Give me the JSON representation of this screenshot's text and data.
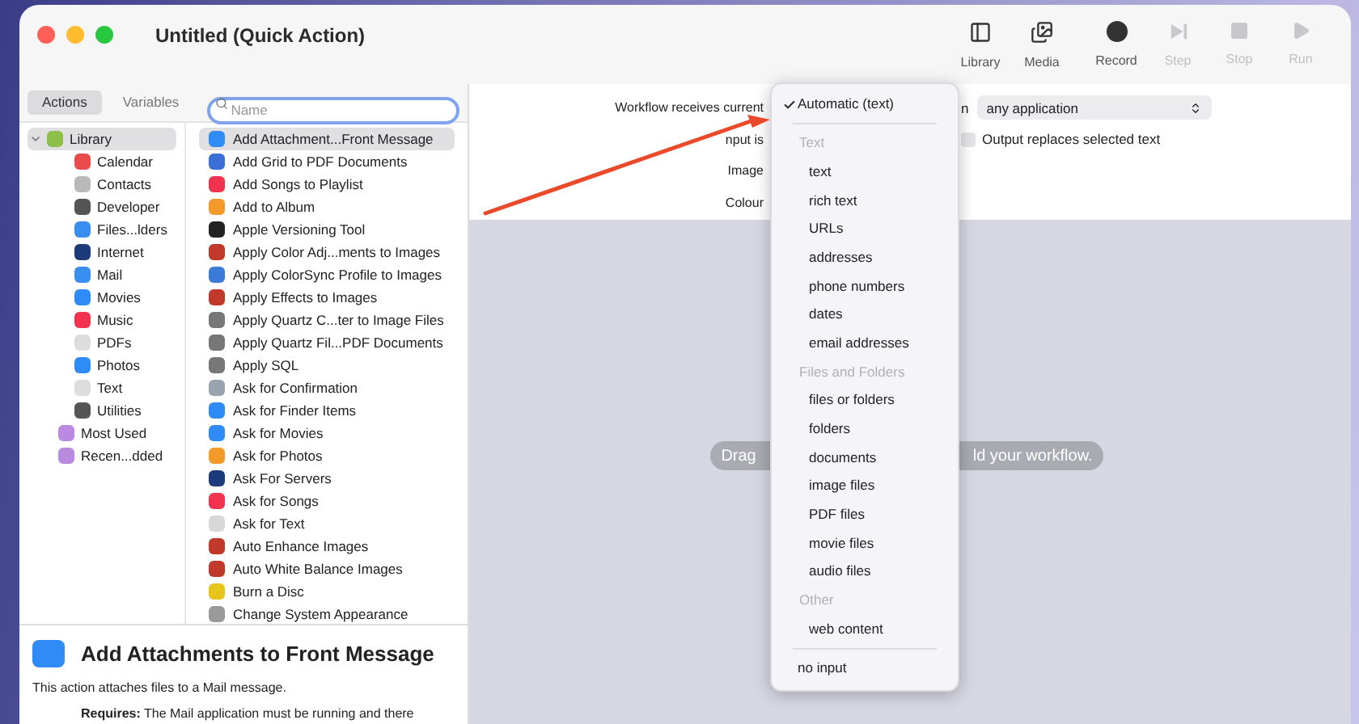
{
  "window": {
    "title": "Untitled (Quick Action)"
  },
  "toolbar": [
    {
      "label": "Library",
      "kind": "library",
      "disabled": false
    },
    {
      "label": "Media",
      "kind": "media",
      "disabled": false
    },
    {
      "label": "Record",
      "kind": "record",
      "disabled": false
    },
    {
      "label": "Step",
      "kind": "step",
      "disabled": true
    },
    {
      "label": "Stop",
      "kind": "stop",
      "disabled": true
    },
    {
      "label": "Run",
      "kind": "run",
      "disabled": true
    }
  ],
  "tabs": [
    {
      "label": "Actions",
      "selected": true
    },
    {
      "label": "Variables",
      "selected": false
    }
  ],
  "search": {
    "placeholder": "Name"
  },
  "library": [
    {
      "label": "Library",
      "selected": true,
      "expanded": true,
      "children": [
        {
          "label": "Calendar",
          "selected": false
        },
        {
          "label": "Contacts",
          "selected": false
        },
        {
          "label": "Developer",
          "selected": false
        },
        {
          "label": "Files...lders",
          "selected": false
        },
        {
          "label": "Internet",
          "selected": false
        },
        {
          "label": "Mail",
          "selected": false
        },
        {
          "label": "Movies",
          "selected": false
        },
        {
          "label": "Music",
          "selected": false
        },
        {
          "label": "PDFs",
          "selected": false
        },
        {
          "label": "Photos",
          "selected": false
        },
        {
          "label": "Text",
          "selected": false
        },
        {
          "label": "Utilities",
          "selected": false
        }
      ]
    },
    {
      "label": "Most Used",
      "selected": false
    },
    {
      "label": "Recen...dded",
      "selected": false
    }
  ],
  "actions": [
    {
      "label": "Add Attachment...Front Message",
      "selected": true
    },
    {
      "label": "Add Grid to PDF Documents",
      "selected": false
    },
    {
      "label": "Add Songs to Playlist",
      "selected": false
    },
    {
      "label": "Add to Album",
      "selected": false
    },
    {
      "label": "Apple Versioning Tool",
      "selected": false
    },
    {
      "label": "Apply Color Adj...ments to Images",
      "selected": false
    },
    {
      "label": "Apply ColorSync Profile to Images",
      "selected": false
    },
    {
      "label": "Apply Effects to Images",
      "selected": false
    },
    {
      "label": "Apply Quartz C...ter to Image Files",
      "selected": false
    },
    {
      "label": "Apply Quartz Fil...PDF Documents",
      "selected": false
    },
    {
      "label": "Apply SQL",
      "selected": false
    },
    {
      "label": "Ask for Confirmation",
      "selected": false
    },
    {
      "label": "Ask for Finder Items",
      "selected": false
    },
    {
      "label": "Ask for Movies",
      "selected": false
    },
    {
      "label": "Ask for Photos",
      "selected": false
    },
    {
      "label": "Ask For Servers",
      "selected": false
    },
    {
      "label": "Ask for Songs",
      "selected": false
    },
    {
      "label": "Ask for Text",
      "selected": false
    },
    {
      "label": "Auto Enhance Images",
      "selected": false
    },
    {
      "label": "Auto White Balance Images",
      "selected": false
    },
    {
      "label": "Burn a Disc",
      "selected": false
    },
    {
      "label": "Change System Appearance",
      "selected": false
    }
  ],
  "description": {
    "title": "Add Attachments to Front Message",
    "text": "This action attaches files to a Mail message.",
    "requires": "**Requires:** The Mail application must be running and there"
  },
  "config": {
    "rows": [
      {
        "label": "Workflow receives current",
        "after": "n"
      },
      {
        "label": "nput is"
      },
      {
        "label": "Image"
      },
      {
        "label": "Colour"
      }
    ],
    "application": "any application",
    "output_replaces": {
      "label": "Output replaces selected text",
      "checked": false
    }
  },
  "canvas": {
    "hint_start": "Drag",
    "hint_end": "ld your workflow."
  },
  "menu": [
    {
      "kind": "option",
      "label": "Automatic (text)",
      "checked": true
    },
    {
      "kind": "separator"
    },
    {
      "kind": "header",
      "label": "Text"
    },
    {
      "kind": "item",
      "label": "text"
    },
    {
      "kind": "item",
      "label": "rich text"
    },
    {
      "kind": "item",
      "label": "URLs"
    },
    {
      "kind": "item",
      "label": "addresses"
    },
    {
      "kind": "item",
      "label": "phone numbers"
    },
    {
      "kind": "item",
      "label": "dates"
    },
    {
      "kind": "item",
      "label": "email addresses"
    },
    {
      "kind": "header",
      "label": "Files and Folders"
    },
    {
      "kind": "item",
      "label": "files or folders"
    },
    {
      "kind": "item",
      "label": "folders"
    },
    {
      "kind": "item",
      "label": "documents"
    },
    {
      "kind": "item",
      "label": "image files"
    },
    {
      "kind": "item",
      "label": "PDF files"
    },
    {
      "kind": "item",
      "label": "movie files"
    },
    {
      "kind": "item",
      "label": "audio files"
    },
    {
      "kind": "header",
      "label": "Other"
    },
    {
      "kind": "item",
      "label": "web content"
    },
    {
      "kind": "separator"
    },
    {
      "kind": "option",
      "label": "no input",
      "checked": false
    }
  ]
}
